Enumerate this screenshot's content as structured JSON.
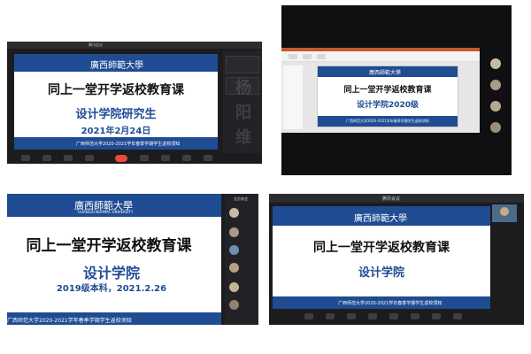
{
  "university_logo": "廣西師範大學",
  "university_en": "GUANGXI NORMAL UNIVERSITY",
  "lesson_title": "同上一堂开学返校教育课",
  "footer_text": "广西师范大学2020-2021学年春季学期学生返校须知",
  "panel1": {
    "window_title": "腾讯会议",
    "subtitle": "设计学院研究生",
    "date": "2021年2月24日",
    "ghost_chars": [
      "杨",
      "阳",
      "维"
    ]
  },
  "panel2": {
    "subtitle": "设计学院2020级"
  },
  "panel3": {
    "subtitle": "设计学院",
    "grade_date": "2019级本科，2021.2.26",
    "participants_title": "全员参会"
  },
  "panel4": {
    "window_title": "腾讯会议",
    "subtitle": "设计学院"
  },
  "colors": {
    "brand_blue": "#1f4c93",
    "end_red": "#e84b3c",
    "dark_ui": "#1c1c1f"
  }
}
